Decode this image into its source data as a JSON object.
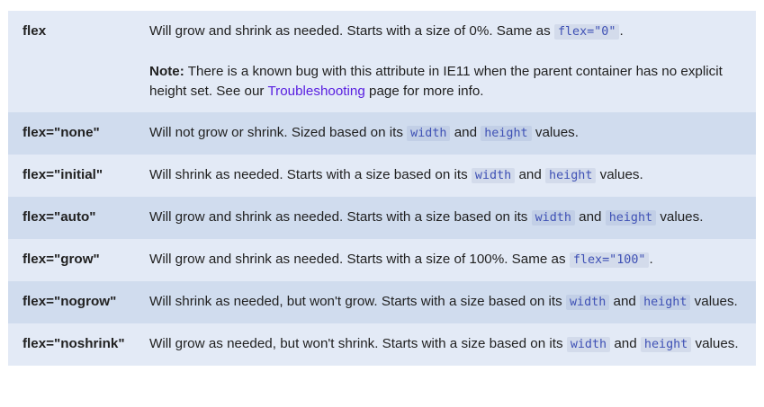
{
  "rows": [
    {
      "attr": "flex",
      "desc_1": "Will grow and shrink as needed. Starts with a size of 0%. Same as ",
      "code_1": "flex=\"0\"",
      "desc_2": ".",
      "note_label": "Note:",
      "note_text_1": " There is a known bug with this attribute in IE11 when the parent container has no explicit height set. See our ",
      "note_link": "Troubleshooting",
      "note_text_2": " page for more info."
    },
    {
      "attr": "flex=\"none\"",
      "desc_1": "Will not grow or shrink. Sized based on its ",
      "code_1": "width",
      "desc_2": " and ",
      "code_2": "height",
      "desc_3": " values."
    },
    {
      "attr": "flex=\"initial\"",
      "desc_1": "Will shrink as needed. Starts with a size based on its ",
      "code_1": "width",
      "desc_2": " and ",
      "code_2": "height",
      "desc_3": " values."
    },
    {
      "attr": "flex=\"auto\"",
      "desc_1": "Will grow and shrink as needed. Starts with a size based on its ",
      "code_1": "width",
      "desc_2": " and ",
      "code_2": "height",
      "desc_3": " values."
    },
    {
      "attr": "flex=\"grow\"",
      "desc_1": "Will grow and shrink as needed. Starts with a size of 100%. Same as ",
      "code_1": "flex=\"100\"",
      "desc_2": "."
    },
    {
      "attr": "flex=\"nogrow\"",
      "desc_1": "Will shrink as needed, but won't grow. Starts with a size based on its ",
      "code_1": "width",
      "desc_2": " and ",
      "code_2": "height",
      "desc_3": " values."
    },
    {
      "attr": "flex=\"noshrink\"",
      "desc_1": "Will grow as needed, but won't shrink. Starts with a size based on its ",
      "code_1": "width",
      "desc_2": " and ",
      "code_2": "height",
      "desc_3": " values."
    }
  ]
}
